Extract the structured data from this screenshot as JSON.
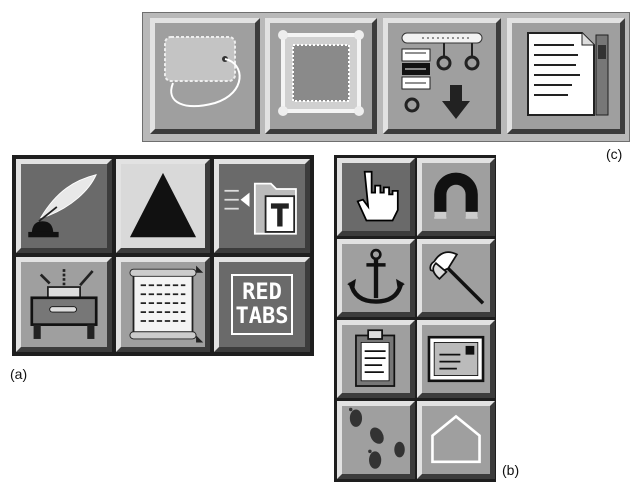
{
  "labels": {
    "a": "(a)",
    "b": "(b)",
    "c": "(c)"
  },
  "panel_c": {
    "icons": [
      {
        "name": "luggage-tag-icon"
      },
      {
        "name": "picture-frame-icon"
      },
      {
        "name": "list-download-icon"
      },
      {
        "name": "document-scroll-icon"
      }
    ]
  },
  "panel_a": {
    "icons": [
      {
        "name": "quill-inkwell-icon"
      },
      {
        "name": "triangle-icon"
      },
      {
        "name": "folder-import-icon"
      },
      {
        "name": "printing-press-icon"
      },
      {
        "name": "scroll-icon"
      },
      {
        "name": "red-tabs-icon",
        "text": "RED\nTABS"
      }
    ]
  },
  "panel_b": {
    "icons": [
      {
        "name": "pointing-hand-icon"
      },
      {
        "name": "horseshoe-magnet-icon"
      },
      {
        "name": "anchor-icon"
      },
      {
        "name": "axe-icon"
      },
      {
        "name": "clipboard-icon"
      },
      {
        "name": "envelope-card-icon"
      },
      {
        "name": "footprints-icon"
      },
      {
        "name": "house-outline-icon"
      }
    ]
  },
  "colors": {
    "face": "#9f9f9f",
    "highlight": "#e2e2e2",
    "shadow": "#3c3c3c",
    "ink": "#111111"
  }
}
